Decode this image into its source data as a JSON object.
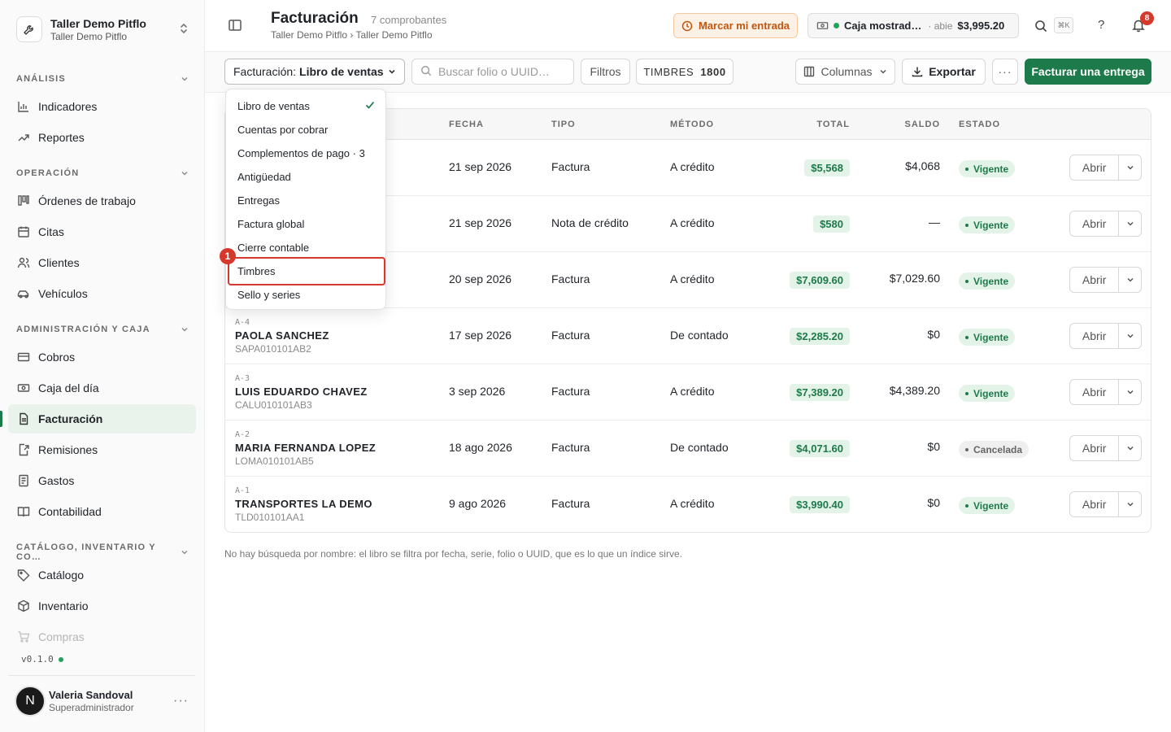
{
  "org": {
    "name": "Taller Demo Pitflo",
    "sub": "Taller Demo Pitflo"
  },
  "sidebar": {
    "sections": [
      {
        "title": "ANÁLISIS",
        "items": [
          "Indicadores",
          "Reportes"
        ]
      },
      {
        "title": "OPERACIÓN",
        "items": [
          "Órdenes de trabajo",
          "Citas",
          "Clientes",
          "Vehículos"
        ]
      },
      {
        "title": "ADMINISTRACIÓN Y CAJA",
        "items": [
          "Cobros",
          "Caja del día",
          "Facturación",
          "Remisiones",
          "Gastos",
          "Contabilidad"
        ]
      },
      {
        "title": "CATÁLOGO, INVENTARIO Y CO…",
        "items": [
          "Catálogo",
          "Inventario",
          "Compras"
        ]
      }
    ],
    "active": "Facturación",
    "version": "v0.1.0"
  },
  "user": {
    "initial": "N",
    "name": "Valeria Sandoval",
    "role": "Superadministrador"
  },
  "header": {
    "title": "Facturación",
    "count": "7 comprobantes",
    "breadcrumb": "Taller Demo Pitflo › Taller Demo Pitflo",
    "clock_in": "Marcar mi entrada",
    "register": {
      "name": "Caja mostrad…",
      "state": "· abie",
      "amount": "$3,995.20"
    },
    "shortcut": "⌘K",
    "help": "?",
    "notifications": "8"
  },
  "toolbar": {
    "view_label": "Facturación:",
    "view_value": "Libro de ventas",
    "search_placeholder": "Buscar folio o UUID…",
    "filters": "Filtros",
    "stamps_label": "TIMBRES",
    "stamps_count": "1800",
    "columns": "Columnas",
    "export": "Exportar",
    "more": "···",
    "primary": "Facturar una entrega"
  },
  "table": {
    "headers": {
      "fecha": "FECHA",
      "tipo": "TIPO",
      "metodo": "MÉTODO",
      "total": "TOTAL",
      "saldo": "SALDO",
      "estado": "ESTADO"
    },
    "open_label": "Abrir",
    "rows": [
      {
        "folio": "",
        "client": "",
        "rfc": "",
        "fecha": "21 sep 2026",
        "tipo": "Factura",
        "metodo": "A crédito",
        "total": "$5,568",
        "saldo": "$4,068",
        "estado": "Vigente"
      },
      {
        "folio": "",
        "client": "",
        "rfc": "",
        "fecha": "21 sep 2026",
        "tipo": "Nota de crédito",
        "metodo": "A crédito",
        "total": "$580",
        "saldo": "—",
        "estado": "Vigente"
      },
      {
        "folio": "",
        "client": "",
        "rfc": "",
        "fecha": "20 sep 2026",
        "tipo": "Factura",
        "metodo": "A crédito",
        "total": "$7,609.60",
        "saldo": "$7,029.60",
        "estado": "Vigente"
      },
      {
        "folio": "A-4",
        "client": "PAOLA SANCHEZ",
        "rfc": "SAPA010101AB2",
        "fecha": "17 sep 2026",
        "tipo": "Factura",
        "metodo": "De contado",
        "total": "$2,285.20",
        "saldo": "$0",
        "estado": "Vigente"
      },
      {
        "folio": "A-3",
        "client": "LUIS EDUARDO CHAVEZ",
        "rfc": "CALU010101AB3",
        "fecha": "3 sep 2026",
        "tipo": "Factura",
        "metodo": "A crédito",
        "total": "$7,389.20",
        "saldo": "$4,389.20",
        "estado": "Vigente"
      },
      {
        "folio": "A-2",
        "client": "MARIA FERNANDA LOPEZ",
        "rfc": "LOMA010101AB5",
        "fecha": "18 ago 2026",
        "tipo": "Factura",
        "metodo": "De contado",
        "total": "$4,071.60",
        "saldo": "$0",
        "estado": "Cancelada"
      },
      {
        "folio": "A-1",
        "client": "TRANSPORTES LA DEMO",
        "rfc": "TLD010101AA1",
        "fecha": "9 ago 2026",
        "tipo": "Factura",
        "metodo": "A crédito",
        "total": "$3,990.40",
        "saldo": "$0",
        "estado": "Vigente"
      }
    ]
  },
  "footnote": "No hay búsqueda por nombre: el libro se filtra por fecha, serie, folio o UUID, que es lo que un índice sirve.",
  "view_menu": {
    "items": [
      "Libro de ventas",
      "Cuentas por cobrar",
      "Complementos de pago · 3",
      "Antigüedad",
      "Entregas",
      "Factura global",
      "Cierre contable",
      "Timbres",
      "Sello y series"
    ],
    "selected": "Libro de ventas",
    "highlighted": "Timbres",
    "marker": "1"
  },
  "colors": {
    "accent": "#1d7a4a",
    "danger": "#d6382b",
    "warning_bg": "#fdf0e4"
  }
}
